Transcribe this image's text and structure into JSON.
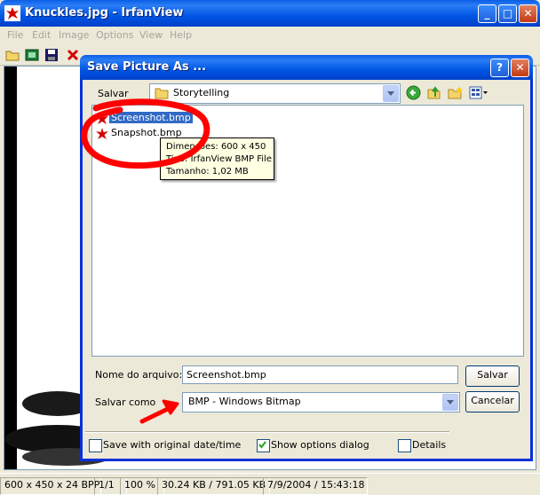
{
  "main_window": {
    "title": "Knuckles.jpg - IrfanView",
    "menu": [
      "File",
      "Edit",
      "Image",
      "Options",
      "View",
      "Help"
    ]
  },
  "status_bar": {
    "dimensions": "600 x 450 x 24 BPP",
    "page": "1/1",
    "zoom": "100 %",
    "size": "30.24 KB / 791.05 KB",
    "datetime": "7/9/2004 / 15:43:18"
  },
  "dialog": {
    "title": "Save Picture As ...",
    "save_in_label": "Salvar",
    "save_in_value": "Storytelling",
    "files": [
      "Screenshot.bmp",
      "Snapshot.bmp"
    ],
    "tooltip": {
      "line1": "Dimensões: 600 x 450",
      "line2": "Tipo: IrfanView BMP File",
      "line3": "Tamanho: 1,02 MB"
    },
    "filename_label": "Nome do arquivo:",
    "filename_value": "Screenshot.bmp",
    "save_as_label": "Salvar como",
    "save_as_value": "BMP - Windows Bitmap",
    "save_button": "Salvar",
    "cancel_button": "Cancelar",
    "options": [
      {
        "label": "Save with original date/time",
        "checked": false
      },
      {
        "label": "Show options dialog",
        "checked": true
      },
      {
        "label": "Details",
        "checked": false
      }
    ]
  },
  "colors": {
    "annotation": "#ff0000",
    "title_blue": "#0055e5"
  }
}
